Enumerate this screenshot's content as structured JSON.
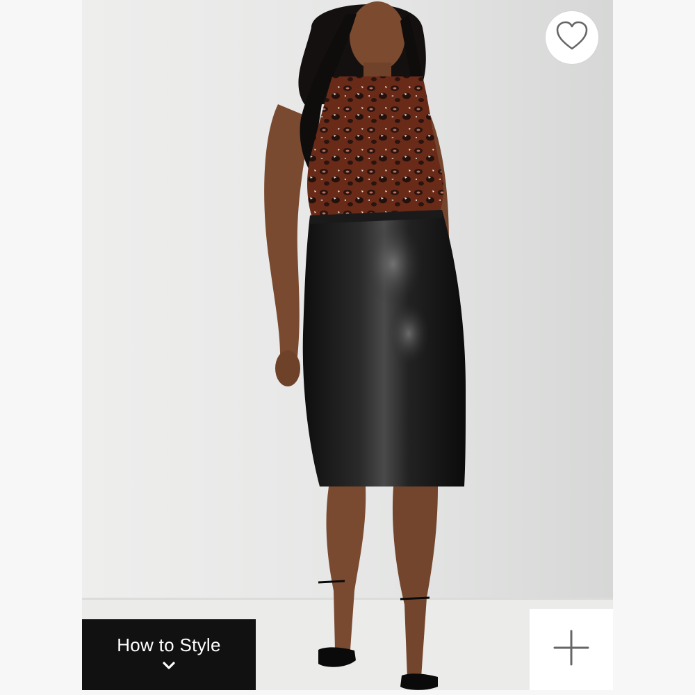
{
  "product_image": {
    "alt": "",
    "icon": "product-photo"
  },
  "favorite": {
    "icon": "heart-icon"
  },
  "how_to_style": {
    "label": "How to Style",
    "icon": "chevron-down-icon"
  },
  "add": {
    "icon": "plus-icon"
  },
  "colors": {
    "page_bg": "#f7f7f7",
    "button_bg": "#111111",
    "button_text": "#ffffff",
    "icon_gray": "#666666"
  }
}
